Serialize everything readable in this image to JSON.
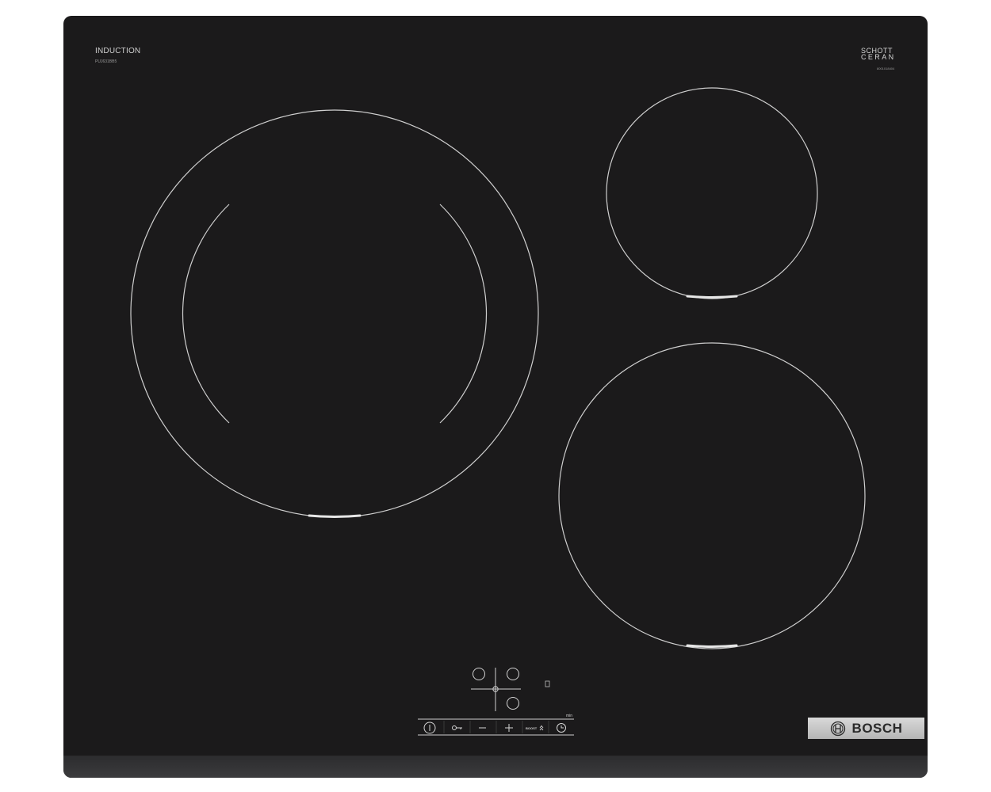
{
  "brand": {
    "name": "BOSCH",
    "series_label": "INDUCTION",
    "model_code": "PUJ631BB5",
    "glass_brand_line1": "SCHOTT",
    "glass_brand_line2": "CERAN",
    "glass_code": "8001018404"
  },
  "controls": {
    "boost_label": "BOOST",
    "timer_unit": "min",
    "buttons": [
      "power-icon",
      "lock-icon",
      "minus-icon",
      "plus-icon",
      "boost-icon",
      "timer-icon"
    ]
  },
  "colors": {
    "glass": "#1b1a1b",
    "marking": "#d0d0d0",
    "badge": "#c8c8c8"
  }
}
